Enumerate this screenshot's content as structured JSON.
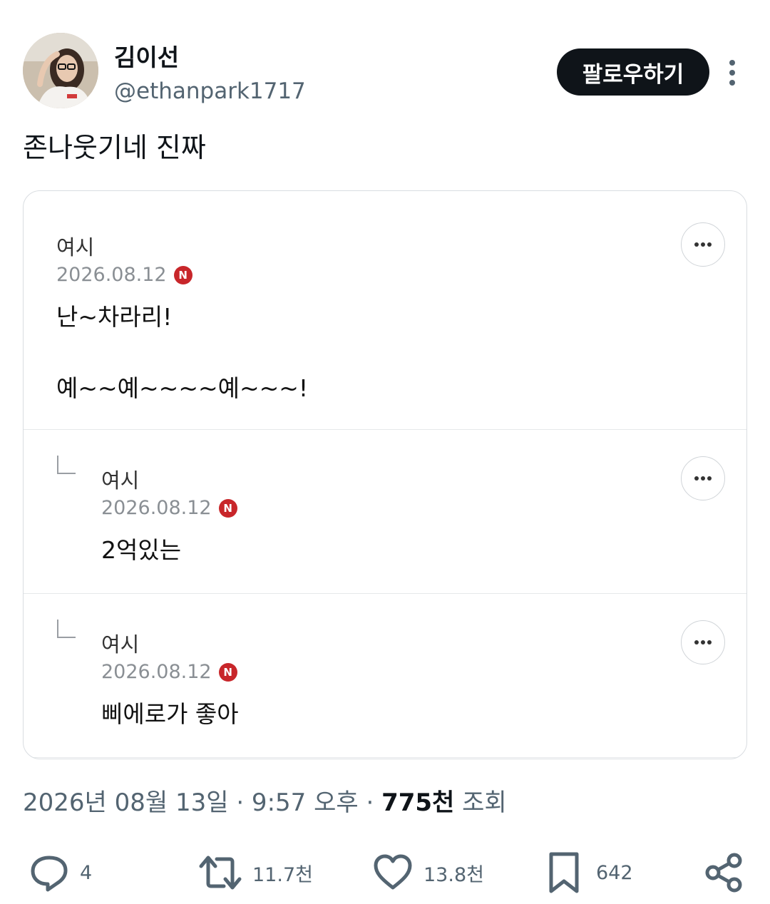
{
  "post": {
    "author_name": "김이선",
    "author_handle": "@ethanpark1717",
    "follow_label": "팔로우하기",
    "text": "존나웃기네 진짜",
    "meta": {
      "datetime": "2026년 08월 13일 · 9:57 오후 · ",
      "views_count": "775천",
      "views_label": " 조회"
    }
  },
  "card": {
    "comments": [
      {
        "author": "여시",
        "date": "2026.08.12",
        "badge": "N",
        "body_line1": "난~차라리!",
        "body_line2": "예~~예~~~~예~~~!"
      },
      {
        "author": "여시",
        "date": "2026.08.12",
        "badge": "N",
        "body_line1": "2억있는"
      },
      {
        "author": "여시",
        "date": "2026.08.12",
        "badge": "N",
        "body_line1": "삐에로가 좋아"
      }
    ]
  },
  "actions": {
    "replies": "4",
    "reposts": "11.7천",
    "likes": "13.8천",
    "bookmarks": "642"
  }
}
